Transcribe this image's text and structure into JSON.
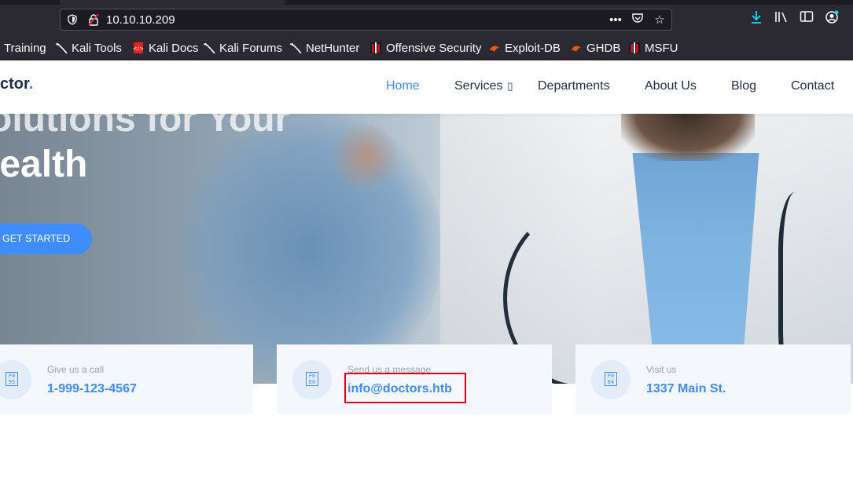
{
  "browser": {
    "url": "10.10.10.209",
    "bookmarks": [
      {
        "label": "Training",
        "icon": "kali-dragon-icon"
      },
      {
        "label": "Kali Tools",
        "icon": "kali-dragon-icon"
      },
      {
        "label": "Kali Docs",
        "icon": "kali-docs-icon"
      },
      {
        "label": "Kali Forums",
        "icon": "kali-dragon-icon"
      },
      {
        "label": "NetHunter",
        "icon": "kali-dragon-icon"
      },
      {
        "label": "Offensive Security",
        "icon": "offsec-icon"
      },
      {
        "label": "Exploit-DB",
        "icon": "exploit-db-icon"
      },
      {
        "label": "GHDB",
        "icon": "ghdb-icon"
      },
      {
        "label": "MSFU",
        "icon": "offsec-icon"
      }
    ]
  },
  "site": {
    "logo_text": "ctor",
    "logo_dot": ".",
    "nav": {
      "home": "Home",
      "services": "Services",
      "departments": "Departments",
      "about": "About Us",
      "blog": "Blog",
      "contact": "Contact"
    },
    "accent_color": "#3f8cff"
  },
  "hero": {
    "title_line1": "olutions for Your",
    "title_line2": "lealth",
    "cta_label": "GET STARTED"
  },
  "cards": [
    {
      "label": "Give us a call",
      "value": "1-999-123-4567",
      "icon": "phone-icon"
    },
    {
      "label": "Send us a message",
      "value": "info@doctors.htb",
      "icon": "envelope-icon"
    },
    {
      "label": "Visit us",
      "value": "1337 Main St.",
      "icon": "map-marker-icon"
    }
  ]
}
